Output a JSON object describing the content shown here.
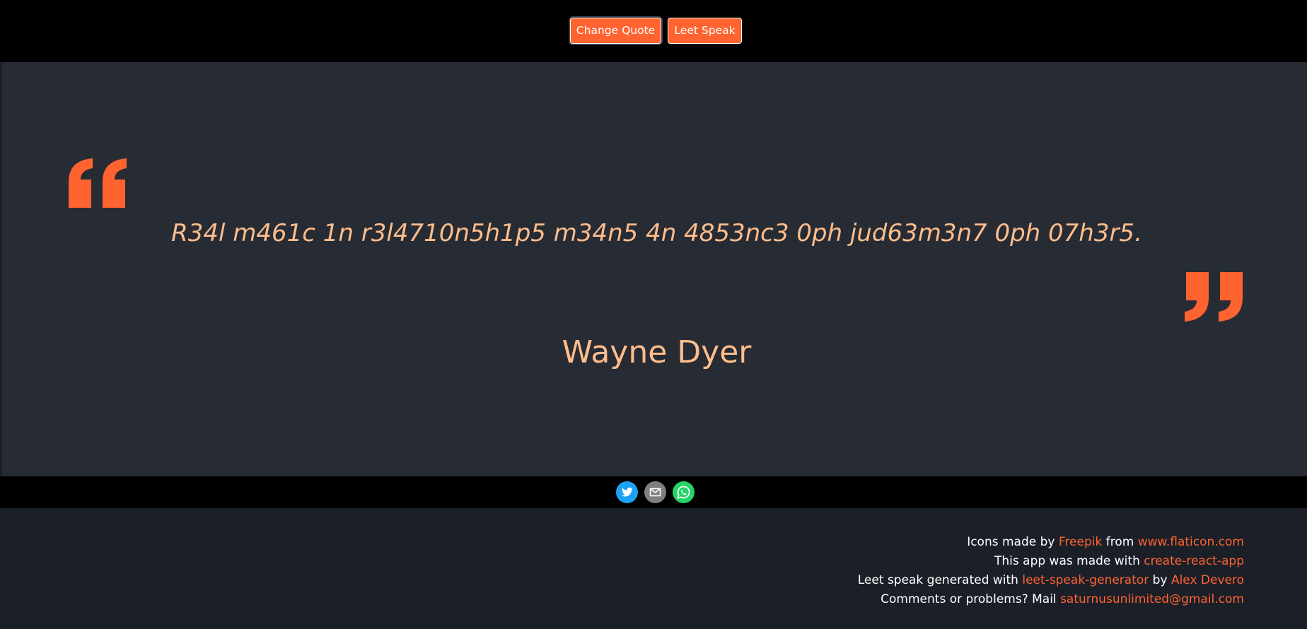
{
  "toolbar": {
    "change_quote_label": "Change Quote",
    "leet_speak_label": "Leet Speak"
  },
  "quote": {
    "text": "R34l m461c 1n r3l4710n5h1p5 m34n5 4n 4853nc3 0ph jud63m3n7 0ph 07h3r5.",
    "author": "Wayne Dyer"
  },
  "share": {
    "icons": [
      "twitter-icon",
      "email-icon",
      "whatsapp-icon"
    ]
  },
  "credits": {
    "line1": {
      "prefix": "Icons made by ",
      "link1": "Freepik",
      "middle": " from ",
      "link2": "www.flaticon.com"
    },
    "line2": {
      "prefix": "This app was made with ",
      "link1": "create-react-app"
    },
    "line3": {
      "prefix": "Leet speak generated with ",
      "link1": "leet-speak-generator",
      "middle": " by ",
      "link2": "Alex Devero"
    },
    "line4": {
      "prefix": "Comments or problems? Mail ",
      "link1": "saturnusunlimited@gmail.com"
    }
  },
  "colors": {
    "accent": "#ff6330",
    "quote_text": "#ffbd8c",
    "panel": "#272b34",
    "background": "#1b1f28",
    "bar": "#000000"
  }
}
